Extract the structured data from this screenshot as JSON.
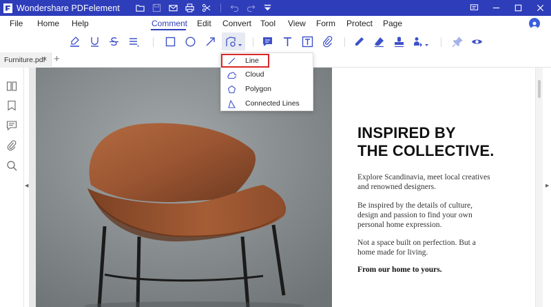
{
  "app": {
    "title": "Wondershare PDFelement"
  },
  "titlebar_icons": [
    "folder-icon",
    "save-icon",
    "mail-icon",
    "print-icon",
    "scissors-icon",
    "undo-icon",
    "redo-icon",
    "dropdown-arrow-icon"
  ],
  "window_controls": [
    "feedback-icon",
    "minimize-icon",
    "maximize-icon",
    "close-icon"
  ],
  "menu": {
    "items": [
      "File",
      "Home",
      "Help",
      "Comment",
      "Edit",
      "Convert",
      "Tool",
      "View",
      "Form",
      "Protect",
      "Page"
    ],
    "active": "Comment"
  },
  "toolbar": {
    "tools": [
      "highlight-icon",
      "underline-icon",
      "strikethrough-icon",
      "text-align-icon",
      "rectangle-icon",
      "oval-icon",
      "arrow-icon",
      "shape-dropdown-icon",
      "note-icon",
      "text-icon",
      "textbox-icon",
      "attachment-icon",
      "pencil-icon",
      "eraser-icon",
      "stamp-icon",
      "signature-icon",
      "pin-icon",
      "eye-icon"
    ]
  },
  "tab": {
    "name": "Furniture.pdf",
    "close": "×",
    "add": "+"
  },
  "sidebar": [
    "thumbnail-icon",
    "bookmark-icon",
    "comment-list-icon",
    "attachment-panel-icon",
    "search-icon"
  ],
  "dropdown": {
    "items": [
      {
        "label": "Line",
        "icon": "line-icon"
      },
      {
        "label": "Cloud",
        "icon": "cloud-icon"
      },
      {
        "label": "Polygon",
        "icon": "polygon-icon"
      },
      {
        "label": "Connected Lines",
        "icon": "connected-lines-icon"
      }
    ],
    "highlighted": "Line"
  },
  "document": {
    "heading_line1": "INSPIRED BY",
    "heading_line2": "THE COLLECTIVE.",
    "para1_l1": "Explore Scandinavia, meet local creatives",
    "para1_l2": "and renowned designers.",
    "para2_l1": "Be inspired by the details of culture,",
    "para2_l2": "design and passion to find your own",
    "para2_l3": "personal home expression.",
    "para3_l1": "Not a space built on perfection. But a",
    "para3_l2": "home made for living.",
    "para4": "From our home to yours."
  },
  "colors": {
    "brand_blue": "#2e3dba",
    "highlight_red": "#d92626",
    "icon_blue": "#3d52c8"
  }
}
